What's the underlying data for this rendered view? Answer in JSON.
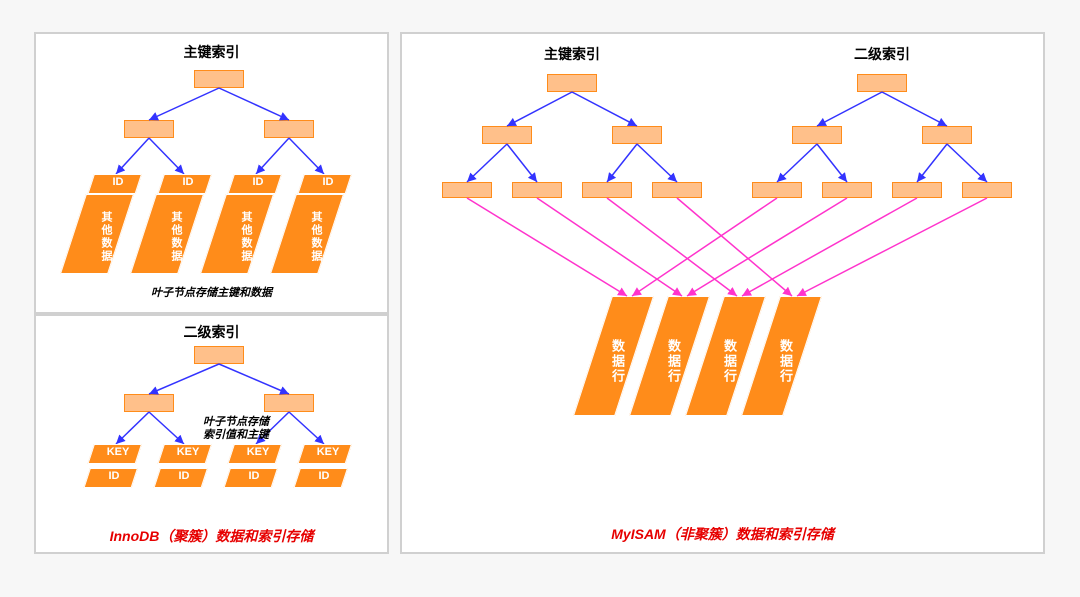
{
  "innodb": {
    "primary": {
      "title": "主键索引",
      "leaf_top_label": "ID",
      "leaf_body_label": "其他数据",
      "note": "叶子节点存储主键和数据"
    },
    "secondary": {
      "title": "二级索引",
      "leaf_top_label": "KEY",
      "leaf_body_label": "ID",
      "note_line1": "叶子节点存储",
      "note_line2": "索引值和主键"
    },
    "caption": "InnoDB（聚簇）数据和索引存储"
  },
  "myisam": {
    "primary_title": "主键索引",
    "secondary_title": "二级索引",
    "data_row_label": "数据行",
    "caption": "MyISAM（非聚簇）数据和索引存储"
  },
  "colors": {
    "node_fill": "#ffc08a",
    "node_border": "#ff8c1a",
    "leaf_fill": "#ff8c1a",
    "arrow_tree": "#3333ff",
    "arrow_pointer": "#ff33cc",
    "caption": "#e60000"
  }
}
